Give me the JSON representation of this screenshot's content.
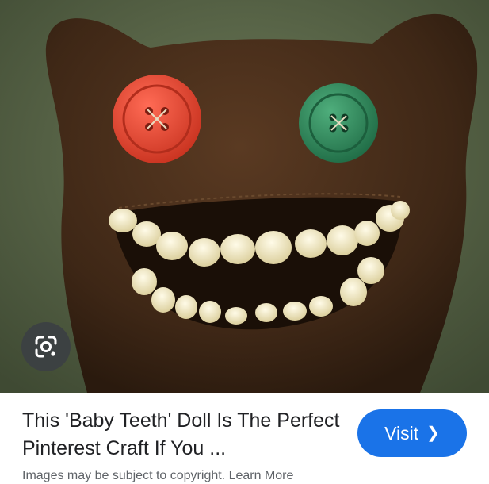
{
  "image": {
    "subject": "brown-felt-doll-with-button-eyes-and-teeth",
    "left_eye_color": "#e5473a",
    "right_eye_color": "#2f8a5a",
    "background_color": "#5b6a4a"
  },
  "lens": {
    "icon": "google-lens-icon"
  },
  "result": {
    "title": "This 'Baby Teeth' Doll Is The Perfect Pinterest Craft If You ...",
    "snippet": "Images may be subject to copyright. Learn More"
  },
  "visit": {
    "label": "Visit",
    "icon": "chevron-right-icon"
  },
  "colors": {
    "accent": "#1a73e8",
    "title": "#202124"
  }
}
